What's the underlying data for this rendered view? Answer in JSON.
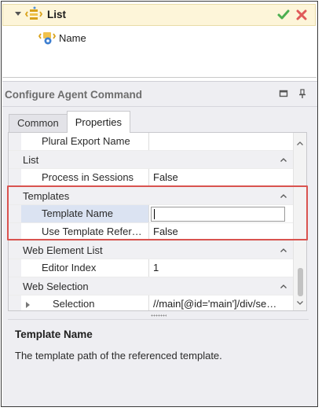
{
  "tree": {
    "root_label": "List",
    "child_label": "Name",
    "root_icon": "web-element-icon",
    "child_icon": "web-element-settings-icon",
    "accept_icon": "checkmark-icon",
    "cancel_icon": "close-icon",
    "accept_color": "#4caf50",
    "cancel_color": "#e05a5a"
  },
  "panel": {
    "title": "Configure Agent Command",
    "maximize_icon": "maximize-icon",
    "pin_icon": "pin-icon"
  },
  "tabs": [
    {
      "label": "Common",
      "active": false
    },
    {
      "label": "Properties",
      "active": true
    }
  ],
  "grid": {
    "rows": [
      {
        "kind": "prop",
        "name": "Plural Export Name",
        "value": ""
      },
      {
        "kind": "cat",
        "name": "List"
      },
      {
        "kind": "prop",
        "name": "Process in Sessions",
        "value": "False"
      },
      {
        "kind": "cat",
        "name": "Templates"
      },
      {
        "kind": "prop",
        "name": "Template Name",
        "value": "",
        "selected": true
      },
      {
        "kind": "prop",
        "name": "Use Template Refer…",
        "value": "False"
      },
      {
        "kind": "cat",
        "name": "Web Element List"
      },
      {
        "kind": "prop",
        "name": "Editor Index",
        "value": "1"
      },
      {
        "kind": "cat",
        "name": "Web Selection"
      },
      {
        "kind": "prop",
        "name": "Selection",
        "value": "//main[@id='main']/div/se…",
        "expandable": true
      }
    ]
  },
  "highlight_color": "#d9534f",
  "description": {
    "title": "Template Name",
    "text": "The template path of the referenced template."
  }
}
